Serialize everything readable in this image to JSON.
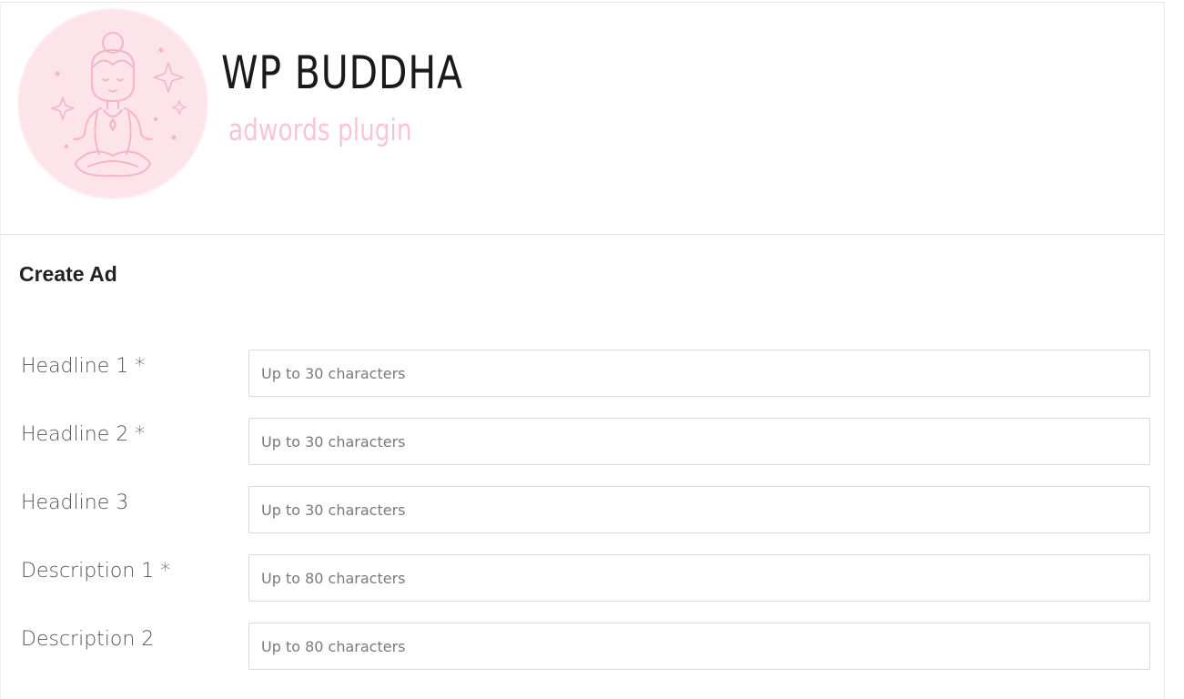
{
  "brand": {
    "title": "WP BUDDHA",
    "subtitle": "adwords plugin",
    "logo_icon": "meditating-buddha-icon",
    "accent_color": "#f7c6d3",
    "logo_bg_color": "#fce4ea"
  },
  "form": {
    "title": "Create Ad",
    "fields": [
      {
        "label": "Headline 1 *",
        "placeholder": "Up to 30 characters",
        "value": ""
      },
      {
        "label": "Headline 2 *",
        "placeholder": "Up to 30 characters",
        "value": ""
      },
      {
        "label": "Headline 3",
        "placeholder": "Up to 30 characters",
        "value": ""
      },
      {
        "label": "Description 1 *",
        "placeholder": "Up to 80 characters",
        "value": ""
      },
      {
        "label": "Description 2",
        "placeholder": "Up to 80 characters",
        "value": ""
      }
    ]
  }
}
